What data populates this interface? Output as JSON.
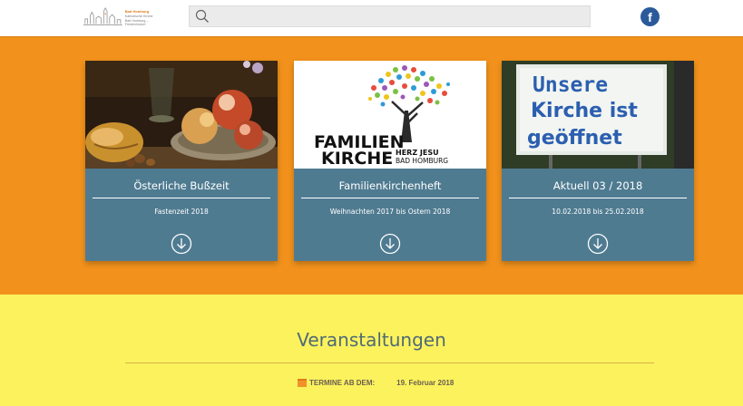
{
  "header": {
    "logo_line1": "Bad Homburg",
    "logo_line2": "Katholische Kirche",
    "logo_line3": "Bad Homburg – Friedrichsdorf",
    "search_placeholder": "",
    "search_icon": "search-icon",
    "facebook_glyph": "f",
    "facebook_icon": "facebook-icon"
  },
  "cards": [
    {
      "title": "Österliche Bußzeit",
      "subtitle": "Fastenzeit 2018",
      "image": "still-life-bread-apples",
      "icon": "download-icon"
    },
    {
      "title": "Familienkirchenheft",
      "subtitle": "Weihnachten 2017 bis Ostern 2018",
      "image_text_main1": "FAMILIEN",
      "image_text_main2": "KIRCHE",
      "image_text_side1": "HERZ JESU",
      "image_text_side2": "BAD HOMBURG",
      "icon": "download-icon"
    },
    {
      "title": "Aktuell 03 / 2018",
      "subtitle": "10.02.2018 bis 25.02.2018",
      "image_text1": "Unsere",
      "image_text2": "Kirche ist",
      "image_text3": "geöffnet",
      "icon": "download-icon"
    }
  ],
  "events": {
    "title": "Veranstaltungen",
    "termine_label": "TERMINE AB DEM:",
    "termine_date": "19. Februar 2018",
    "calendar_icon": "calendar-icon"
  },
  "colors": {
    "orange_band": "#f2921c",
    "yellow_band": "#fbf25d",
    "card": "#4f7b91",
    "facebook": "#2b5a9b"
  }
}
